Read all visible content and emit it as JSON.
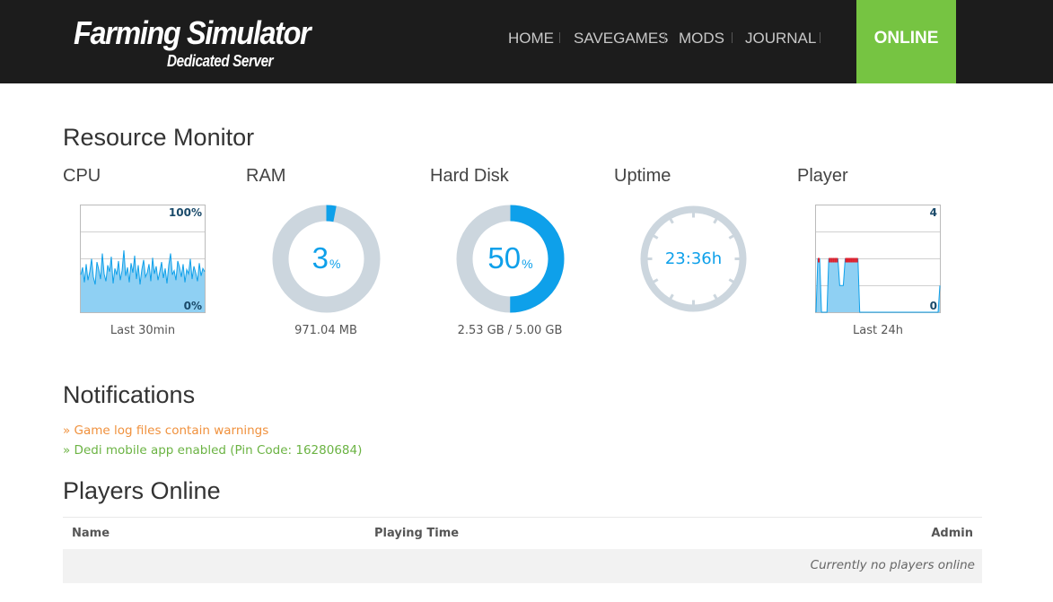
{
  "header": {
    "logo_main": "Farming Simulator",
    "logo_sub": "Dedicated Server",
    "nav": [
      "HOME",
      "SAVEGAMES",
      "MODS",
      "JOURNAL"
    ],
    "status": "ONLINE",
    "status_color": "#76c442"
  },
  "resource_monitor": {
    "title": "Resource Monitor",
    "cpu": {
      "title": "CPU",
      "max_label": "100%",
      "min_label": "0%",
      "caption": "Last 30min",
      "history_percent": [
        35,
        42,
        28,
        45,
        30,
        38,
        50,
        33,
        26,
        47,
        40,
        31,
        55,
        36,
        29,
        44,
        38,
        52,
        27,
        41,
        35,
        48,
        30,
        39,
        58,
        34,
        42,
        28,
        46,
        37,
        53,
        31,
        44,
        26,
        40,
        49,
        33,
        37,
        45,
        29,
        51,
        36,
        43,
        30,
        38,
        47,
        32,
        41,
        27,
        44,
        55,
        35,
        39,
        30,
        48,
        42,
        33,
        45,
        28,
        40,
        36,
        50,
        31,
        43,
        37,
        29,
        46,
        34,
        41,
        38
      ]
    },
    "ram": {
      "title": "RAM",
      "percent": 3,
      "percent_value": "3",
      "unit": "%",
      "caption": "971.04 MB"
    },
    "disk": {
      "title": "Hard Disk",
      "percent": 50,
      "percent_value": "50",
      "unit": "%",
      "caption": "2.53 GB / 5.00 GB"
    },
    "uptime": {
      "title": "Uptime",
      "value": "23:36h"
    },
    "player": {
      "title": "Player",
      "max_label": "4",
      "min_label": "0",
      "caption": "Last 24h",
      "history_players": [
        0,
        2,
        2,
        0,
        0,
        0,
        0,
        2,
        2,
        2,
        2,
        2,
        2,
        1,
        1,
        1,
        2,
        2,
        2,
        2,
        2,
        2,
        2,
        2,
        0,
        0,
        0,
        0,
        0,
        0,
        0,
        0,
        0,
        0,
        0,
        0,
        0,
        0,
        0,
        0,
        0,
        0,
        0,
        0,
        0,
        0,
        0,
        0,
        0,
        0,
        0,
        0,
        0,
        0,
        0,
        0,
        0,
        0,
        0,
        0,
        0,
        0,
        0,
        0,
        0,
        0,
        0,
        0,
        1
      ]
    },
    "colors": {
      "accent": "#0ea0ea",
      "track": "#ccd6de",
      "grid": "#d0d0d0",
      "alert": "#e0202c"
    }
  },
  "notifications": {
    "title": "Notifications",
    "items": [
      {
        "text": "» Game log files contain warnings",
        "color": "#f0913d"
      },
      {
        "text": "» Dedi mobile app enabled (Pin Code: 16280684)",
        "color": "#6bb343"
      }
    ]
  },
  "players_online": {
    "title": "Players Online",
    "columns": [
      "Name",
      "Playing Time",
      "Admin"
    ],
    "empty_message": "Currently no players online"
  }
}
